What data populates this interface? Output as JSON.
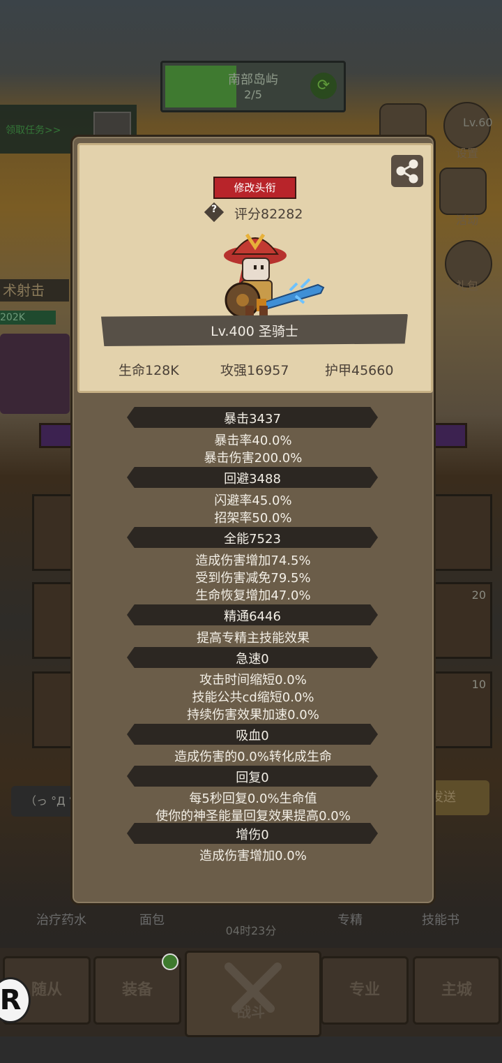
{
  "background": {
    "zone_name": "南部岛屿",
    "zone_progress": "2/5",
    "quest_label": "领取任务>>",
    "side_menu": [
      {
        "label": "设置"
      },
      {
        "label": "活动"
      },
      {
        "label": "礼包"
      }
    ],
    "level_tag": "Lv.60",
    "left_skill": "术射击",
    "left_hp": "202K",
    "slot_counts": [
      "20",
      "10"
    ],
    "chat_placeholder": "（っ °Д °",
    "send_label": "发送",
    "consumables": [
      {
        "label": "治疗药水"
      },
      {
        "label": "面包"
      },
      {
        "label": "专精"
      },
      {
        "label": "技能书"
      }
    ],
    "timer": "04时23分",
    "tabs": [
      {
        "label": "随从"
      },
      {
        "label": "装备"
      },
      {
        "label": "战斗"
      },
      {
        "label": "专业"
      },
      {
        "label": "主城"
      }
    ]
  },
  "profile": {
    "rename_button": "修改头衔",
    "score_icon": "?",
    "score": "评分82282",
    "level_class": "Lv.400 圣骑士",
    "hp": "生命128K",
    "attack": "攻强16957",
    "armor": "护甲45660"
  },
  "stats": [
    {
      "title": "暴击3437",
      "lines": [
        "暴击率40.0%",
        "暴击伤害200.0%"
      ]
    },
    {
      "title": "回避3488",
      "lines": [
        "闪避率45.0%",
        "招架率50.0%"
      ]
    },
    {
      "title": "全能7523",
      "lines": [
        "造成伤害增加74.5%",
        "受到伤害减免79.5%",
        "生命恢复增加47.0%"
      ]
    },
    {
      "title": "精通6446",
      "lines": [
        "提高专精主技能效果"
      ]
    },
    {
      "title": "急速0",
      "lines": [
        "攻击时间缩短0.0%",
        "技能公共cd缩短0.0%",
        "持续伤害效果加速0.0%"
      ]
    },
    {
      "title": "吸血0",
      "lines": [
        "造成伤害的0.0%转化成生命"
      ]
    },
    {
      "title": "回复0",
      "lines": [
        "每5秒回复0.0%生命值",
        "使你的神圣能量回复效果提高0.0%"
      ]
    },
    {
      "title": "增伤0",
      "lines": [
        "造成伤害增加0.0%"
      ]
    }
  ]
}
